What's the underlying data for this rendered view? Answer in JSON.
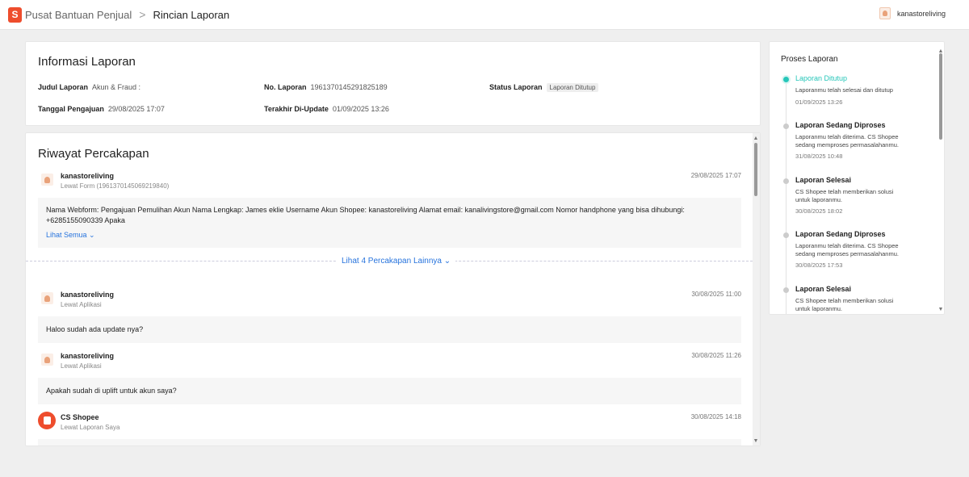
{
  "header": {
    "logo_glyph": "S",
    "breadcrumb_home": "Pusat Bantuan Penjual",
    "breadcrumb_sep": ">",
    "breadcrumb_current": "Rincian Laporan",
    "username": "kanastoreliving"
  },
  "info": {
    "title": "Informasi Laporan",
    "judul_label": "Judul Laporan",
    "judul_value": "Akun & Fraud :",
    "no_label": "No. Laporan",
    "no_value": "1961370145291825189",
    "status_label": "Status Laporan",
    "status_value": "Laporan Ditutup",
    "tanggal_label": "Tanggal Pengajuan",
    "tanggal_value": "29/08/2025 17:07",
    "update_label": "Terakhir Di-Update",
    "update_value": "01/09/2025 13:26"
  },
  "chat": {
    "title": "Riwayat Percakapan",
    "more_link": "Lihat 4 Percakapan Lainnya",
    "messages": [
      {
        "name": "kanastoreliving",
        "via": "Lewat Form (1961370145069219840)",
        "time": "29/08/2025 17:07",
        "body": "Nama Webform: Pengajuan Pemulihan Akun Nama Lengkap: James eklie Username Akun Shopee: kanastoreliving Alamat email: kanalivingstore@gmail.com Nomor handphone yang bisa dihubungi: +6285155090339 Apaka",
        "see_all": "Lihat Semua"
      },
      {
        "name": "kanastoreliving",
        "via": "Lewat Aplikasi",
        "time": "30/08/2025 11:00",
        "body": "Haloo sudah ada update nya?"
      },
      {
        "name": "kanastoreliving",
        "via": "Lewat Aplikasi",
        "time": "30/08/2025 11:26",
        "body": "Apakah sudah di uplift untuk akun saya?"
      },
      {
        "name": "CS Shopee",
        "via": "Lewat Laporan Saya",
        "time": "30/08/2025 14:18",
        "body": ""
      }
    ]
  },
  "process": {
    "title": "Proses Laporan",
    "steps": [
      {
        "title": "Laporan Ditutup",
        "desc": "Laporanmu telah selesai dan ditutup",
        "date": "01/09/2025 13:26",
        "active": true
      },
      {
        "title": "Laporan Sedang Diproses",
        "desc": "Laporanmu telah diterima. CS Shopee sedang memproses permasalahanmu.",
        "date": "31/08/2025 10:48",
        "active": false
      },
      {
        "title": "Laporan Selesai",
        "desc": "CS Shopee telah memberikan solusi untuk laporanmu.",
        "date": "30/08/2025 18:02",
        "active": false
      },
      {
        "title": "Laporan Sedang Diproses",
        "desc": "Laporanmu telah diterima. CS Shopee sedang memproses permasalahanmu.",
        "date": "30/08/2025 17:53",
        "active": false
      },
      {
        "title": "Laporan Selesai",
        "desc": "CS Shopee telah memberikan solusi untuk laporanmu.",
        "date": "",
        "active": false
      }
    ]
  },
  "colors": {
    "brand": "#ee4d2d",
    "active": "#26c6b9",
    "link": "#2673dd"
  }
}
